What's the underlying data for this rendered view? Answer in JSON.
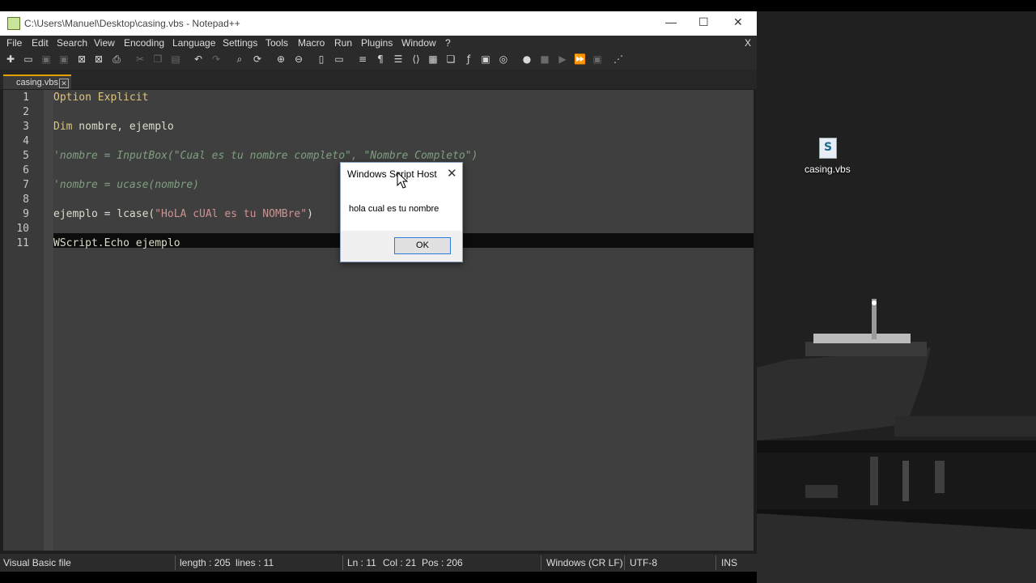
{
  "window": {
    "title": "C:\\Users\\Manuel\\Desktop\\casing.vbs - Notepad++",
    "minimize_glyph": "—",
    "maximize_glyph": "☐",
    "close_glyph": "✕"
  },
  "menu": {
    "items": [
      "File",
      "Edit",
      "Search",
      "View",
      "Encoding",
      "Language",
      "Settings",
      "Tools",
      "Macro",
      "Run",
      "Plugins",
      "Window",
      "?"
    ],
    "close_doc_glyph": "X"
  },
  "toolbar": {
    "icons": [
      {
        "name": "new-file-icon",
        "glyph": "✚",
        "dim": false
      },
      {
        "name": "open-file-icon",
        "glyph": "▭",
        "dim": false
      },
      {
        "name": "save-icon",
        "glyph": "▣",
        "dim": true
      },
      {
        "name": "save-all-icon",
        "glyph": "▣",
        "dim": true
      },
      {
        "name": "close-icon",
        "glyph": "⊠",
        "dim": false
      },
      {
        "name": "close-all-icon",
        "glyph": "⊠",
        "dim": false
      },
      {
        "name": "print-icon",
        "glyph": "⎙",
        "dim": false
      },
      {
        "name": "cut-icon",
        "glyph": "✂",
        "dim": true
      },
      {
        "name": "copy-icon",
        "glyph": "❐",
        "dim": true
      },
      {
        "name": "paste-icon",
        "glyph": "▤",
        "dim": true
      },
      {
        "name": "undo-icon",
        "glyph": "↶",
        "dim": false
      },
      {
        "name": "redo-icon",
        "glyph": "↷",
        "dim": true
      },
      {
        "name": "find-icon",
        "glyph": "⌕",
        "dim": false
      },
      {
        "name": "replace-icon",
        "glyph": "⟳",
        "dim": false
      },
      {
        "name": "zoom-in-icon",
        "glyph": "⊕",
        "dim": false
      },
      {
        "name": "zoom-out-icon",
        "glyph": "⊖",
        "dim": false
      },
      {
        "name": "sync-vertical-icon",
        "glyph": "▯",
        "dim": false
      },
      {
        "name": "sync-horizontal-icon",
        "glyph": "▭",
        "dim": false
      },
      {
        "name": "word-wrap-icon",
        "glyph": "≡",
        "dim": false
      },
      {
        "name": "show-all-chars-icon",
        "glyph": "¶",
        "dim": false
      },
      {
        "name": "indent-guide-icon",
        "glyph": "☰",
        "dim": false
      },
      {
        "name": "xml-tag-icon",
        "glyph": "⟨⟩",
        "dim": false
      },
      {
        "name": "doc-map-icon",
        "glyph": "▦",
        "dim": false
      },
      {
        "name": "doc-list-icon",
        "glyph": "❏",
        "dim": false
      },
      {
        "name": "function-list-icon",
        "glyph": "ƒ",
        "dim": false
      },
      {
        "name": "folder-workspace-icon",
        "glyph": "▣",
        "dim": false
      },
      {
        "name": "monitoring-icon",
        "glyph": "◎",
        "dim": false
      },
      {
        "name": "record-macro-icon",
        "glyph": "●",
        "dim": false
      },
      {
        "name": "stop-macro-icon",
        "glyph": "■",
        "dim": true
      },
      {
        "name": "play-macro-icon",
        "glyph": "▶",
        "dim": true
      },
      {
        "name": "run-macro-multiple-icon",
        "glyph": "⏩",
        "dim": false
      },
      {
        "name": "save-macro-icon",
        "glyph": "▣",
        "dim": true
      },
      {
        "name": "spell-check-icon",
        "glyph": "⋰",
        "dim": false
      }
    ]
  },
  "tab": {
    "label": "casing.vbs",
    "close_glyph": "✕"
  },
  "editor": {
    "lines": [
      {
        "n": "1",
        "parts": [
          {
            "t": "Option Explicit",
            "c": "kw"
          }
        ]
      },
      {
        "n": "2",
        "parts": []
      },
      {
        "n": "3",
        "parts": [
          {
            "t": "Dim",
            "c": "kw"
          },
          {
            "t": " nombre, ejemplo",
            "c": "id"
          }
        ]
      },
      {
        "n": "4",
        "parts": []
      },
      {
        "n": "5",
        "parts": [
          {
            "t": "'nombre = InputBox(\"Cual es tu nombre completo\", \"Nombre Completo\")",
            "c": "cm"
          }
        ]
      },
      {
        "n": "6",
        "parts": []
      },
      {
        "n": "7",
        "parts": [
          {
            "t": "'nombre = ucase(nombre)",
            "c": "cm"
          }
        ]
      },
      {
        "n": "8",
        "parts": []
      },
      {
        "n": "9",
        "parts": [
          {
            "t": "ejemplo = lcase(",
            "c": "id"
          },
          {
            "t": "\"HoLA cUAl es tu NOMBre\"",
            "c": "st"
          },
          {
            "t": ")",
            "c": "id"
          }
        ]
      },
      {
        "n": "10",
        "parts": []
      },
      {
        "n": "11",
        "parts": [
          {
            "t": "WScript.Echo ejemplo",
            "c": "id"
          }
        ]
      }
    ]
  },
  "status": {
    "lang": "Visual Basic file",
    "length": "length : 205",
    "lines": "lines : 11",
    "ln": "Ln : 11",
    "col": "Col : 21",
    "pos": "Pos : 206",
    "eol": "Windows (CR LF)",
    "enc": "UTF-8",
    "ins": "INS"
  },
  "dialog": {
    "title": "Windows Script Host",
    "message": "hola cual es tu nombre",
    "ok": "OK",
    "close_glyph": "✕"
  },
  "desktop": {
    "icon_label": "casing.vbs",
    "icon_glyph": "S"
  }
}
